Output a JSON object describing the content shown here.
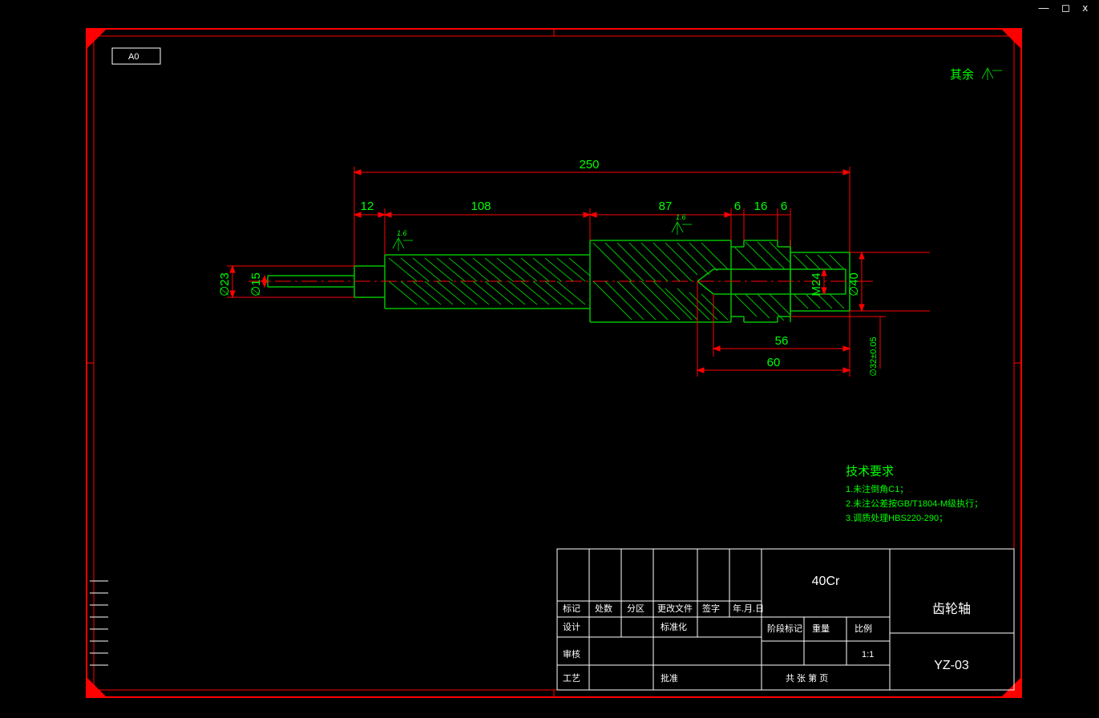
{
  "sheet_label": "A0",
  "surface_note": "其余",
  "dims": {
    "overall": "250",
    "d12": "12",
    "d108": "108",
    "d87": "87",
    "d6a": "6",
    "d16": "16",
    "d6b": "6",
    "d56": "56",
    "d60": "60",
    "dia23": "∅23",
    "dia15": "∅15",
    "m24": "M24",
    "dia40": "∅40",
    "dia32": "∅32±0.05",
    "ra1": "1.6",
    "ra2": "1.6"
  },
  "tech_req": {
    "title": "技术要求",
    "line1": "1.未注倒角C1；",
    "line2": "2.未注公差按GB/T1804-M级执行；",
    "line3": "3.调质处理HBS220-290；"
  },
  "title_block": {
    "material": "40Cr",
    "part_name": "齿轮轴",
    "drawing_no": "YZ-03",
    "scale": "1:1",
    "cells": {
      "r1c1": "标记",
      "r1c2": "处数",
      "r1c3": "分区",
      "r1c4": "更改文件",
      "r1c5": "签字",
      "r1c6": "年.月.日",
      "r2c1": "设计",
      "r2c4": "标准化",
      "r3c1": "审核",
      "r4c1": "工艺",
      "r4c4": "批准",
      "blk_a": "阶段标记",
      "blk_b": "重量",
      "blk_c": "比例",
      "sheet": "共  张  第  页"
    }
  },
  "window_minimize": "—",
  "window_maximize": "◻",
  "window_close": "x"
}
